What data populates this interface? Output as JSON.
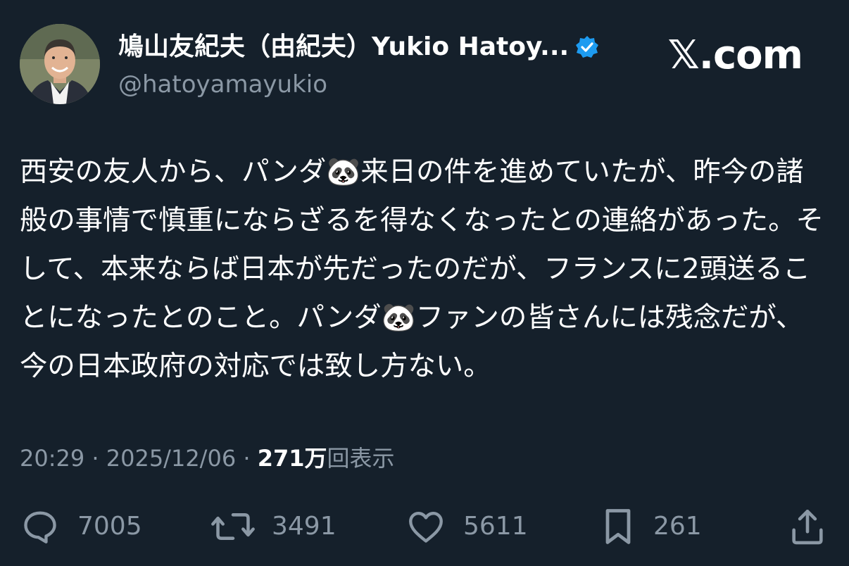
{
  "header": {
    "display_name": "鳩山友紀夫（由紀夫）Yukio Hatoy...",
    "handle": "@hatoyamayukio",
    "brand": "𝕏.com",
    "verified_color": "#1d9bf0"
  },
  "tweet": {
    "text": "西安の友人から、パンダ🐼来日の件を進めていたが、昨今の諸般の事情で慎重にならざるを得なくなったとの連絡があった。そして、本来ならば日本が先だったのだが、フランスに2頭送ることになったとのこと。パンダ🐼ファンの皆さんには残念だが、今の日本政府の対応では致し方ない。"
  },
  "meta": {
    "time": "20:29",
    "separator1": " · ",
    "date": "2025/12/06",
    "separator2": " · ",
    "views_count": "271万",
    "views_label": "回表示"
  },
  "actions": {
    "reply_count": "7005",
    "repost_count": "3491",
    "like_count": "5611",
    "bookmark_count": "261"
  },
  "colors": {
    "background": "#15202b",
    "secondary_text": "#8b98a5",
    "primary_text": "#ffffff"
  }
}
